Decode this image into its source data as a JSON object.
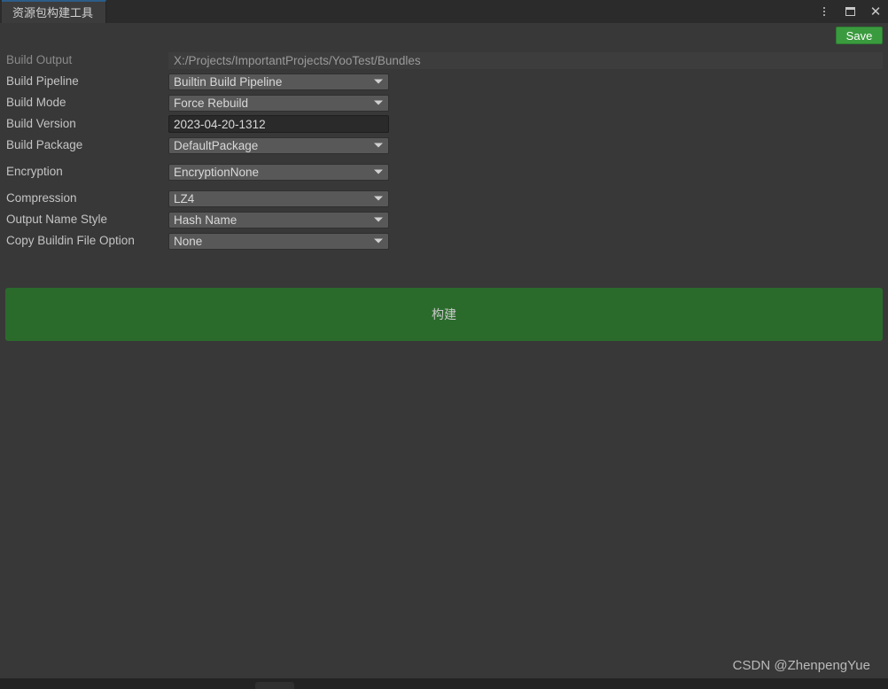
{
  "window": {
    "tab_title": "资源包构建工具",
    "accent_color": "#2c5d87",
    "background_color": "#383838",
    "controls": {
      "menu_icon": "kebab-menu-icon",
      "maximize_icon": "maximize-icon",
      "close_icon": "close-icon"
    }
  },
  "toolbar": {
    "save_label": "Save",
    "save_color": "#3a9b3e"
  },
  "form": {
    "rows": [
      {
        "label": "Build Output",
        "value": "X:/Projects/ImportantProjects/YooTest/Bundles",
        "type": "readonly"
      },
      {
        "label": "Build Pipeline",
        "value": "Builtin Build Pipeline",
        "type": "dropdown"
      },
      {
        "label": "Build Mode",
        "value": "Force Rebuild",
        "type": "dropdown"
      },
      {
        "label": "Build Version",
        "value": "2023-04-20-1312",
        "type": "text"
      },
      {
        "label": "Build Package",
        "value": "DefaultPackage",
        "type": "dropdown"
      },
      {
        "label": "Encryption",
        "value": "EncryptionNone",
        "type": "dropdown"
      },
      {
        "label": "Compression",
        "value": "LZ4",
        "type": "dropdown"
      },
      {
        "label": "Output Name Style",
        "value": "Hash Name",
        "type": "dropdown"
      },
      {
        "label": "Copy Buildin File Option",
        "value": "None",
        "type": "dropdown"
      }
    ]
  },
  "build": {
    "label": "构建",
    "color": "#2a6b2c"
  },
  "watermark": {
    "text": "CSDN @ZhenpengYue"
  }
}
